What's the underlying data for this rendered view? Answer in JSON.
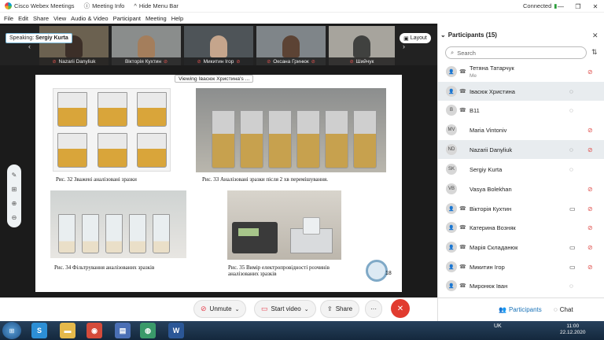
{
  "titlebar": {
    "app": "Cisco Webex Meetings",
    "meeting_info": "Meeting Info",
    "hide_menu": "Hide Menu Bar",
    "status": "Connected"
  },
  "menu": [
    "File",
    "Edit",
    "Share",
    "View",
    "Audio & Video",
    "Participant",
    "Meeting",
    "Help"
  ],
  "speaking": {
    "label": "Speaking:",
    "name": "Sergiy Kurta"
  },
  "layout_label": "Layout",
  "video_tiles": [
    "Nazarii Danyliuk",
    "Вікторія Кухтин",
    "Микитин Ігор",
    "Оксана Гринюк",
    "Шийчук"
  ],
  "viewing_banner": "Viewing Івасюк Христина's ...",
  "slide": {
    "captions": [
      "Рис. 32 Зважені аналізовані зразки",
      "Рис. 33  Аналізовані зразки після 2 хв перемішування.",
      "Рис. 34 Фільтрування аналізованих зразків",
      "Рис. 35 Вимір електропровідності розчинів аналізованих зразків"
    ],
    "page_number": "18"
  },
  "controls": {
    "unmute": "Unmute",
    "start_video": "Start video",
    "share": "Share",
    "more": "···"
  },
  "panel": {
    "title": "Participants (15)",
    "search_placeholder": "Search",
    "participants": [
      {
        "name": "Тетяна Татарчук",
        "sub": "Me",
        "avatar": ""
      },
      {
        "name": "Івасюк Христина",
        "sub": "",
        "avatar": ""
      },
      {
        "name": "B11",
        "sub": "",
        "avatar": "B"
      },
      {
        "name": "Maria Vintoniv",
        "sub": "",
        "avatar": "MV"
      },
      {
        "name": "Nazarii Danyliuk",
        "sub": "",
        "avatar": "ND"
      },
      {
        "name": "Sergiy Kurta",
        "sub": "",
        "avatar": "SK"
      },
      {
        "name": "Vasya Bolekhan",
        "sub": "",
        "avatar": "VB"
      },
      {
        "name": "Вікторія Кухтин",
        "sub": "",
        "avatar": ""
      },
      {
        "name": "Катерина Возняк",
        "sub": "",
        "avatar": ""
      },
      {
        "name": "Марія Складанюк",
        "sub": "",
        "avatar": ""
      },
      {
        "name": "Микитин Ігор",
        "sub": "",
        "avatar": ""
      },
      {
        "name": "Миронюк Іван",
        "sub": "",
        "avatar": ""
      }
    ],
    "participants_btn": "Participants",
    "chat_btn": "Chat"
  },
  "taskbar": {
    "lang": "UK",
    "time": "11:00",
    "date": "22.12.2020"
  }
}
